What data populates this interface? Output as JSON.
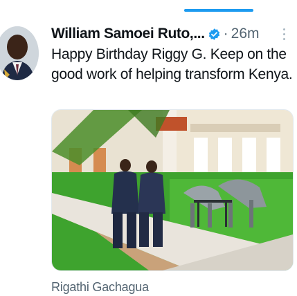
{
  "tab_indicator_color": "#1d9bf0",
  "tweet": {
    "display_name": "William Samoei Ruto,...",
    "verified_icon": "verified-badge-icon",
    "separator": "·",
    "time": "26m",
    "text": "Happy Birthday Riggy G. Keep on the good work of helping transform Kenya.",
    "more_icon": "vertical-ellipsis-icon",
    "avatar_icon": "profile-photo",
    "media_alt": "photo",
    "tagged_user": "Rigathi Gachagua"
  },
  "colors": {
    "accent": "#1d9bf0",
    "text": "#0f1419",
    "muted": "#536471"
  }
}
